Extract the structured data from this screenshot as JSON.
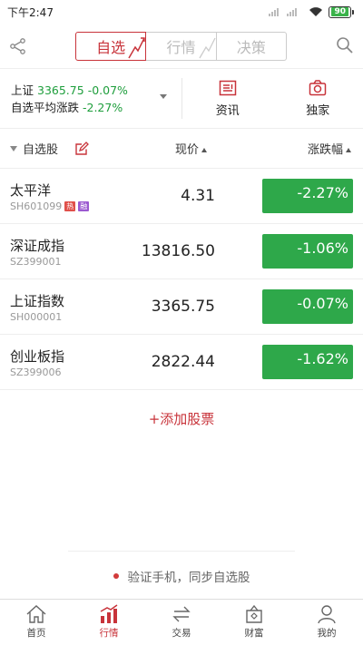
{
  "status": {
    "time": "下午2:47",
    "battery": "90"
  },
  "nav": {
    "tabs": [
      {
        "label": "自选",
        "active": true
      },
      {
        "label": "行情",
        "active": false
      },
      {
        "label": "决策",
        "active": false
      }
    ]
  },
  "summary": {
    "index_name": "上证",
    "index_value": "3365.75",
    "index_change": "-0.07%",
    "avg_label": "自选平均涨跌",
    "avg_change": "-2.27%",
    "buttons": [
      "资讯",
      "独家"
    ]
  },
  "list_header": {
    "title": "自选股",
    "price": "现价",
    "change": "涨跌幅"
  },
  "stocks": [
    {
      "name": "太平洋",
      "code": "SH601099",
      "tags": [
        "热",
        "融"
      ],
      "price": "4.31",
      "change": "-2.27%"
    },
    {
      "name": "深证成指",
      "code": "SZ399001",
      "tags": [],
      "price": "13816.50",
      "change": "-1.06%"
    },
    {
      "name": "上证指数",
      "code": "SH000001",
      "tags": [],
      "price": "3365.75",
      "change": "-0.07%"
    },
    {
      "name": "创业板指",
      "code": "SZ399006",
      "tags": [],
      "price": "2822.44",
      "change": "-1.62%"
    }
  ],
  "add_stock": "+添加股票",
  "verify_text": "验证手机，同步自选股",
  "tabbar": [
    {
      "label": "首页",
      "icon": "home-icon"
    },
    {
      "label": "行情",
      "icon": "market-bars-icon",
      "active": true
    },
    {
      "label": "交易",
      "icon": "trade-arrows-icon"
    },
    {
      "label": "财富",
      "icon": "wealth-bag-icon"
    },
    {
      "label": "我的",
      "icon": "user-icon"
    }
  ],
  "colors": {
    "accent": "#c8333a",
    "down": "#2ea84a",
    "text_green": "#1e9e3c"
  }
}
